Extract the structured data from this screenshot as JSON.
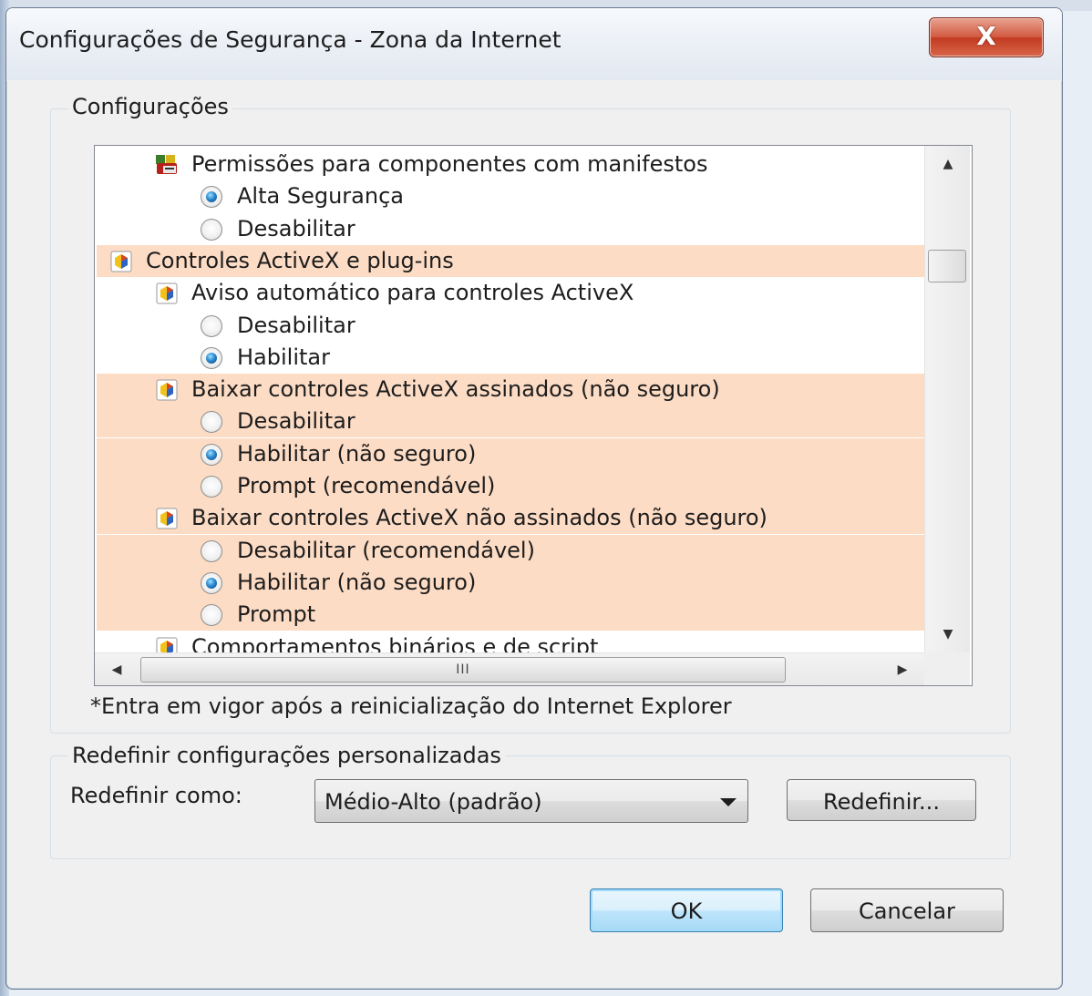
{
  "window": {
    "title": "Configurações de Segurança - Zona da Internet",
    "close_glyph": "X"
  },
  "settings_group": {
    "legend": "Configurações",
    "tree": [
      {
        "kind": "setting",
        "icon": "components-manifest-icon",
        "label": "Permissões para componentes com manifestos",
        "highlighted": false
      },
      {
        "kind": "option",
        "label": "Alta Segurança",
        "checked": true,
        "highlighted": false
      },
      {
        "kind": "option",
        "label": "Desabilitar",
        "checked": false,
        "highlighted": false
      },
      {
        "kind": "category",
        "icon": "activex-icon",
        "label": "Controles ActiveX e plug-ins",
        "highlighted": true
      },
      {
        "kind": "setting",
        "icon": "activex-icon",
        "label": "Aviso automático para controles ActiveX",
        "highlighted": false
      },
      {
        "kind": "option",
        "label": "Desabilitar",
        "checked": false,
        "highlighted": false
      },
      {
        "kind": "option",
        "label": "Habilitar",
        "checked": true,
        "highlighted": false
      },
      {
        "kind": "setting",
        "icon": "activex-icon",
        "label": "Baixar controles ActiveX assinados (não seguro)",
        "highlighted": true
      },
      {
        "kind": "option",
        "label": "Desabilitar",
        "checked": false,
        "highlighted": true
      },
      {
        "kind": "option",
        "label": "Habilitar (não seguro)",
        "checked": true,
        "highlighted": true
      },
      {
        "kind": "option",
        "label": "Prompt (recomendável)",
        "checked": false,
        "highlighted": true
      },
      {
        "kind": "setting",
        "icon": "activex-icon",
        "label": "Baixar controles ActiveX não assinados (não seguro)",
        "highlighted": true
      },
      {
        "kind": "option",
        "label": "Desabilitar (recomendável)",
        "checked": false,
        "highlighted": true
      },
      {
        "kind": "option",
        "label": "Habilitar (não seguro)",
        "checked": true,
        "highlighted": true
      },
      {
        "kind": "option",
        "label": "Prompt",
        "checked": false,
        "highlighted": true
      },
      {
        "kind": "setting",
        "icon": "activex-icon",
        "label": "Comportamentos binários e de script",
        "highlighted": false
      }
    ],
    "hscroll_grip": "III",
    "note": "*Entra em vigor após a reinicialização do Internet Explorer"
  },
  "reset_group": {
    "legend": "Redefinir configurações personalizadas",
    "reset_as_label": "Redefinir como:",
    "reset_level": "Médio-Alto (padrão)",
    "reset_button": "Redefinir..."
  },
  "footer": {
    "ok": "OK",
    "cancel": "Cancelar"
  },
  "colors": {
    "highlight": "#fddcc5",
    "default_button": "#bee6fd",
    "close_button": "#c23a21"
  }
}
